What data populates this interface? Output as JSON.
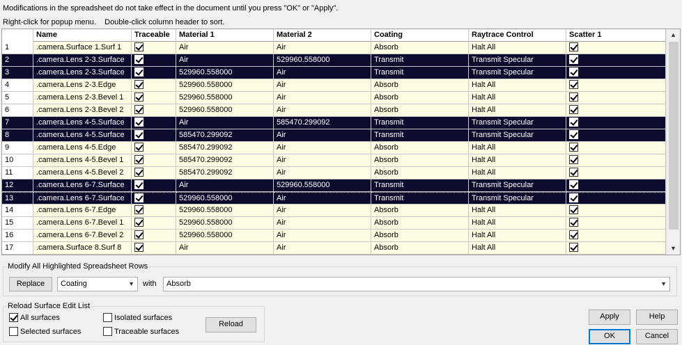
{
  "info": {
    "line1": "Modifications in the spreadsheet do not take effect in the document until you press \"OK\" or \"Apply\".",
    "line2": "Right-click for popup menu.    Double-click column header to sort."
  },
  "table": {
    "columns": [
      "Name",
      "Traceable",
      "Material 1",
      "Material 2",
      "Coating",
      "Raytrace Control",
      "Scatter 1"
    ],
    "rows": [
      {
        "n": "1",
        "name": ".camera.Surface 1.Surf 1",
        "traceable": true,
        "m1": "Air",
        "m2": "Air",
        "coating": "Absorb",
        "rc": "Halt All",
        "scatter": true,
        "selected": false
      },
      {
        "n": "2",
        "name": ".camera.Lens 2-3.Surface",
        "traceable": true,
        "m1": "Air",
        "m2": "529960.558000",
        "coating": "Transmit",
        "rc": "Transmit Specular",
        "scatter": true,
        "selected": true
      },
      {
        "n": "3",
        "name": ".camera.Lens 2-3.Surface",
        "traceable": true,
        "m1": "529960.558000",
        "m2": "Air",
        "coating": "Transmit",
        "rc": "Transmit Specular",
        "scatter": true,
        "selected": true
      },
      {
        "n": "4",
        "name": ".camera.Lens 2-3.Edge",
        "traceable": true,
        "m1": "529960.558000",
        "m2": "Air",
        "coating": "Absorb",
        "rc": "Halt All",
        "scatter": true,
        "selected": false
      },
      {
        "n": "5",
        "name": ".camera.Lens 2-3.Bevel 1",
        "traceable": true,
        "m1": "529960.558000",
        "m2": "Air",
        "coating": "Absorb",
        "rc": "Halt All",
        "scatter": true,
        "selected": false
      },
      {
        "n": "6",
        "name": ".camera.Lens 2-3.Bevel 2",
        "traceable": true,
        "m1": "529960.558000",
        "m2": "Air",
        "coating": "Absorb",
        "rc": "Halt All",
        "scatter": true,
        "selected": false
      },
      {
        "n": "7",
        "name": ".camera.Lens 4-5.Surface",
        "traceable": true,
        "m1": "Air",
        "m2": "585470.299092",
        "coating": "Transmit",
        "rc": "Transmit Specular",
        "scatter": true,
        "selected": true
      },
      {
        "n": "8",
        "name": ".camera.Lens 4-5.Surface",
        "traceable": true,
        "m1": "585470.299092",
        "m2": "Air",
        "coating": "Transmit",
        "rc": "Transmit Specular",
        "scatter": true,
        "selected": true
      },
      {
        "n": "9",
        "name": ".camera.Lens 4-5.Edge",
        "traceable": true,
        "m1": "585470.299092",
        "m2": "Air",
        "coating": "Absorb",
        "rc": "Halt All",
        "scatter": true,
        "selected": false
      },
      {
        "n": "10",
        "name": ".camera.Lens 4-5.Bevel 1",
        "traceable": true,
        "m1": "585470.299092",
        "m2": "Air",
        "coating": "Absorb",
        "rc": "Halt All",
        "scatter": true,
        "selected": false
      },
      {
        "n": "11",
        "name": ".camera.Lens 4-5.Bevel 2",
        "traceable": true,
        "m1": "585470.299092",
        "m2": "Air",
        "coating": "Absorb",
        "rc": "Halt All",
        "scatter": true,
        "selected": false
      },
      {
        "n": "12",
        "name": ".camera.Lens 6-7.Surface",
        "traceable": true,
        "m1": "Air",
        "m2": "529960.558000",
        "coating": "Transmit",
        "rc": "Transmit Specular",
        "scatter": true,
        "selected": true
      },
      {
        "n": "13",
        "name": ".camera.Lens 6-7.Surface",
        "traceable": true,
        "m1": "529960.558000",
        "m2": "Air",
        "coating": "Transmit",
        "rc": "Transmit Specular",
        "scatter": true,
        "selected": true
      },
      {
        "n": "14",
        "name": ".camera.Lens 6-7.Edge",
        "traceable": true,
        "m1": "529960.558000",
        "m2": "Air",
        "coating": "Absorb",
        "rc": "Halt All",
        "scatter": true,
        "selected": false
      },
      {
        "n": "15",
        "name": ".camera.Lens 6-7.Bevel 1",
        "traceable": true,
        "m1": "529960.558000",
        "m2": "Air",
        "coating": "Absorb",
        "rc": "Halt All",
        "scatter": true,
        "selected": false
      },
      {
        "n": "16",
        "name": ".camera.Lens 6-7.Bevel 2",
        "traceable": true,
        "m1": "529960.558000",
        "m2": "Air",
        "coating": "Absorb",
        "rc": "Halt All",
        "scatter": true,
        "selected": false
      },
      {
        "n": "17",
        "name": ".camera.Surface 8.Surf 8",
        "traceable": true,
        "m1": "Air",
        "m2": "Air",
        "coating": "Absorb",
        "rc": "Halt All",
        "scatter": true,
        "selected": false
      }
    ]
  },
  "modify": {
    "title": "Modify All Highlighted Spreadsheet Rows",
    "replace_label": "Replace",
    "field_value": "Coating",
    "with_label": "with",
    "with_value": "Absorb"
  },
  "reload": {
    "title": "Reload Surface Edit List",
    "all_surfaces": "All surfaces",
    "selected_surfaces": "Selected surfaces",
    "isolated_surfaces": "Isolated surfaces",
    "traceable_surfaces": "Traceable surfaces",
    "reload_label": "Reload",
    "all_checked": true
  },
  "buttons": {
    "apply": "Apply",
    "help": "Help",
    "ok": "OK",
    "cancel": "Cancel"
  },
  "colors": {
    "selected_row": "#0c0b2d",
    "cell_bg": "#fdfce2"
  }
}
